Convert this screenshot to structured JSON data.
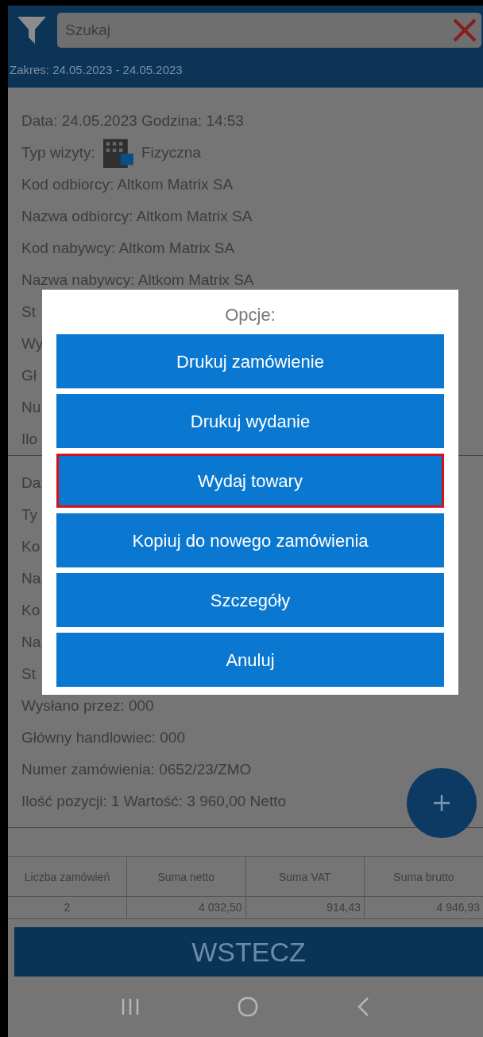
{
  "search": {
    "placeholder": "Szukaj"
  },
  "range": "Zakres: 24.05.2023 - 24.05.2023",
  "orders": [
    {
      "lines": [
        {
          "kind": "text",
          "text": "Data:  24.05.2023 Godzina:  14:53"
        },
        {
          "kind": "visit",
          "label": "Typ wizyty:",
          "value": "Fizyczna"
        },
        {
          "kind": "text",
          "text": "Kod odbiorcy: Altkom Matrix SA"
        },
        {
          "kind": "text",
          "text": "Nazwa odbiorcy: Altkom Matrix SA"
        },
        {
          "kind": "text",
          "text": "Kod nabywcy: Altkom Matrix SA"
        },
        {
          "kind": "text",
          "text": "Nazwa nabywcy: Altkom Matrix SA"
        },
        {
          "kind": "text",
          "text": "St"
        },
        {
          "kind": "text",
          "text": "Wy"
        },
        {
          "kind": "text",
          "text": "Gł"
        },
        {
          "kind": "text",
          "text": "Nu"
        },
        {
          "kind": "text",
          "text": "Ilo"
        }
      ]
    },
    {
      "lines": [
        {
          "kind": "text",
          "text": "Da"
        },
        {
          "kind": "text",
          "text": "Ty"
        },
        {
          "kind": "text",
          "text": "Ko"
        },
        {
          "kind": "text",
          "text": "Na"
        },
        {
          "kind": "text",
          "text": "Ko"
        },
        {
          "kind": "text",
          "text": "Na"
        },
        {
          "kind": "text",
          "text": "St"
        },
        {
          "kind": "text",
          "text": "Wysłano przez:  000"
        },
        {
          "kind": "text",
          "text": "Główny handlowiec:  000"
        },
        {
          "kind": "text",
          "text": "Numer zamówienia: 0652/23/ZMO"
        },
        {
          "kind": "text",
          "text": "Ilość pozycji: 1  Wartość:  3 960,00 Netto"
        }
      ]
    }
  ],
  "summary": {
    "columns": [
      "Liczba zamówień",
      "Suma netto",
      "Suma VAT",
      "Suma brutto"
    ],
    "rows": [
      [
        "2",
        "4 032,50",
        "914,43",
        "4 946,93"
      ]
    ]
  },
  "back_button": "WSTECZ",
  "dialog": {
    "title": "Opcje:",
    "options": [
      {
        "label": "Drukuj zamówienie",
        "selected": false
      },
      {
        "label": "Drukuj wydanie",
        "selected": false
      },
      {
        "label": "Wydaj towary",
        "selected": true
      },
      {
        "label": "Kopiuj do nowego zamówienia",
        "selected": false
      },
      {
        "label": "Szczegóły",
        "selected": false
      },
      {
        "label": "Anuluj",
        "selected": false
      }
    ]
  }
}
